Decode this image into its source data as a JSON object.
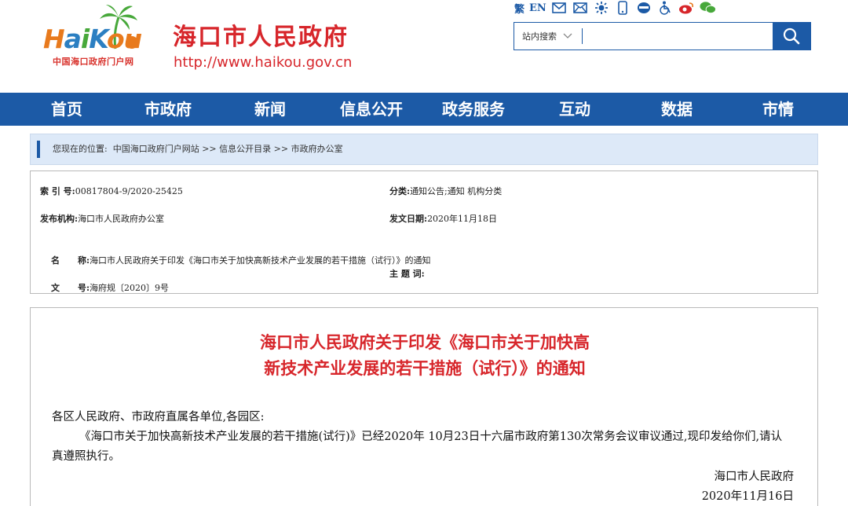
{
  "header": {
    "logo_word": {
      "h": "H",
      "a": "a",
      "i": "i",
      "k": "K",
      "ou": "ou"
    },
    "logo_subtitle": "中国海口政府门户网",
    "site_title": "海口市人民政府",
    "site_url": "http://www.haikou.gov.cn",
    "util": {
      "traditional_label": "繁",
      "english_label": "EN"
    },
    "search": {
      "scope_label": "站内搜索",
      "placeholder": ""
    }
  },
  "nav": {
    "items": [
      {
        "label": "首页"
      },
      {
        "label": "市政府"
      },
      {
        "label": "新闻"
      },
      {
        "label": "信息公开"
      },
      {
        "label": "政务服务"
      },
      {
        "label": "互动"
      },
      {
        "label": "数据"
      },
      {
        "label": "市情"
      }
    ]
  },
  "breadcrumb": {
    "prefix": "您现在的位置:",
    "items": [
      "中国海口政府门户网站",
      "信息公开目录",
      "市政府办公室"
    ],
    "separator": ">>"
  },
  "meta": {
    "index_no": {
      "label": "索 引 号:",
      "value": "00817804-9/2020-25425"
    },
    "category": {
      "label": "分类:",
      "value": "通知公告;通知   机构分类"
    },
    "publisher": {
      "label": "发布机构:",
      "value": "海口市人民政府办公室"
    },
    "date": {
      "label": "发文日期:",
      "value": "2020年11月18日"
    },
    "name": {
      "label": "名      称:",
      "value": "海口市人民政府关于印发《海口市关于加快高新技术产业发展的若干措施（试行）》的通知"
    },
    "doc_no": {
      "label": "文      号:",
      "value": "海府规〔2020〕9号"
    },
    "keywords": {
      "label": "主 题 词:",
      "value": ""
    }
  },
  "document": {
    "title_line1": "海口市人民政府关于印发《海口市关于加快高",
    "title_line2": "新技术产业发展的若干措施（试行）》的通知",
    "salutation": "各区人民政府、市政府直属各单位,各园区:",
    "body_line1": "《海口市关于加快高新技术产业发展的若干措施(试行)》已经2020年 10月23日十六届市政府第130次常务会议审议通过,现印发给你们,请认",
    "body_line2": "真遵照执行。",
    "signature": "海口市人民政府",
    "sign_date": "2020年11月16日"
  },
  "colors": {
    "brand_blue": "#1c5aa6",
    "title_red": "#d7262b",
    "breadcrumb_bg": "#dde9f8"
  }
}
